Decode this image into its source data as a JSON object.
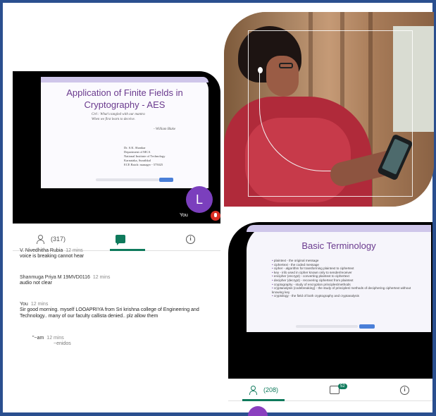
{
  "left_panel": {
    "slide": {
      "title": "Application of Finite Fields in Cryptography - AES",
      "quote_line1": "Ctrl : What's tangled with our mantra",
      "quote_line2": "When we first learn to deceive.",
      "quote_author": "- William Blake",
      "presenter_lines": [
        "Dr. S.K. Shankar",
        "Department of MCA",
        "National Institute of Technology",
        "Karnataka, Surathkal",
        "ECE Batch: manager - 575025"
      ]
    },
    "tile": {
      "avatar_letter": "L",
      "self_label": "You"
    },
    "tabs": {
      "participants": "(317)",
      "info_glyph": "i"
    },
    "chat": [
      {
        "who": "V. Nivedhitha Rubia",
        "time": "12 mins",
        "text": "voice is breaking cannot hear"
      },
      {
        "who": "Shanmuga Priya M 19MVD0116",
        "time": "12 mins",
        "text": "audio not clear"
      },
      {
        "who": "You",
        "time": "12 mins",
        "text": "Sir good morning. myself LOOAPRIYA from Sri krishna college of Engineering and Technology.. many of our faculty callista denied.. plz allow them"
      },
      {
        "who": "\"~am",
        "time": "12 mins",
        "text": "~enidos"
      }
    ]
  },
  "right_panel": {
    "slide": {
      "title": "Basic Terminology",
      "bullets": [
        "plaintext - the original message",
        "ciphertext - the coded message",
        "cipher - algorithm for transforming plaintext to ciphertext",
        "key - info used in cipher known only to sender/receiver",
        "encipher (encrypt) - converting plaintext to ciphertext",
        "decipher (decrypt) - recovering ciphertext from plaintext",
        "cryptography - study of encryption principles/methods",
        "cryptanalysis (codebreaking) - the study of principles/ methods of deciphering ciphertext without knowing key",
        "cryptology - the field of both cryptography and cryptanalysis"
      ]
    },
    "tabs": {
      "participants": "(208)",
      "chat_badge": "52",
      "info_glyph": "i"
    }
  },
  "colors": {
    "frame": "#2a4f8f",
    "meet_green": "#0f7a5c",
    "slide_title": "#6a3a8e",
    "avatar": "#7b3fbd"
  }
}
